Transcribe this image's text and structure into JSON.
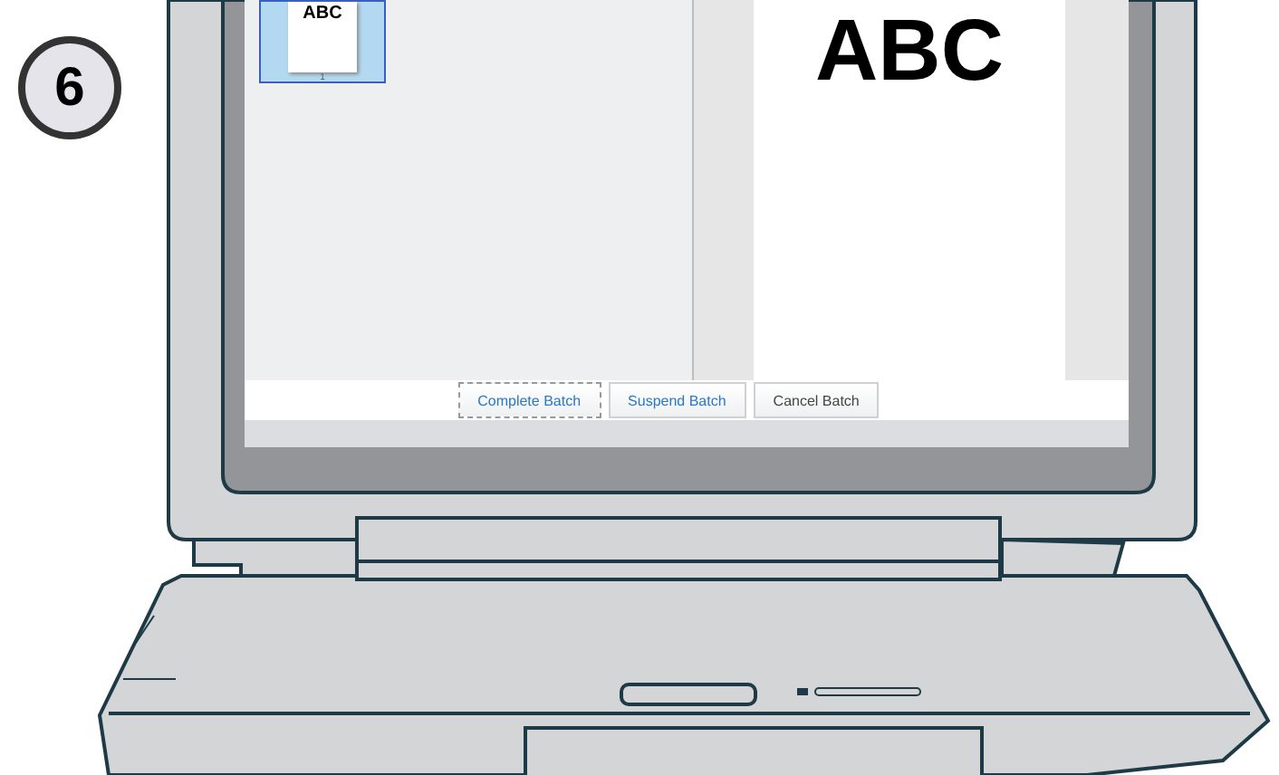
{
  "step_badge": "6",
  "thumbnails": [
    {
      "label": "ABC",
      "page_number": "1",
      "selected": true
    }
  ],
  "preview": {
    "text": "ABC"
  },
  "buttons": [
    {
      "label": "Complete Batch",
      "kind": "action",
      "focused": true
    },
    {
      "label": "Suspend Batch",
      "kind": "action",
      "focused": false
    },
    {
      "label": "Cancel Batch",
      "kind": "cancel",
      "focused": false
    }
  ]
}
